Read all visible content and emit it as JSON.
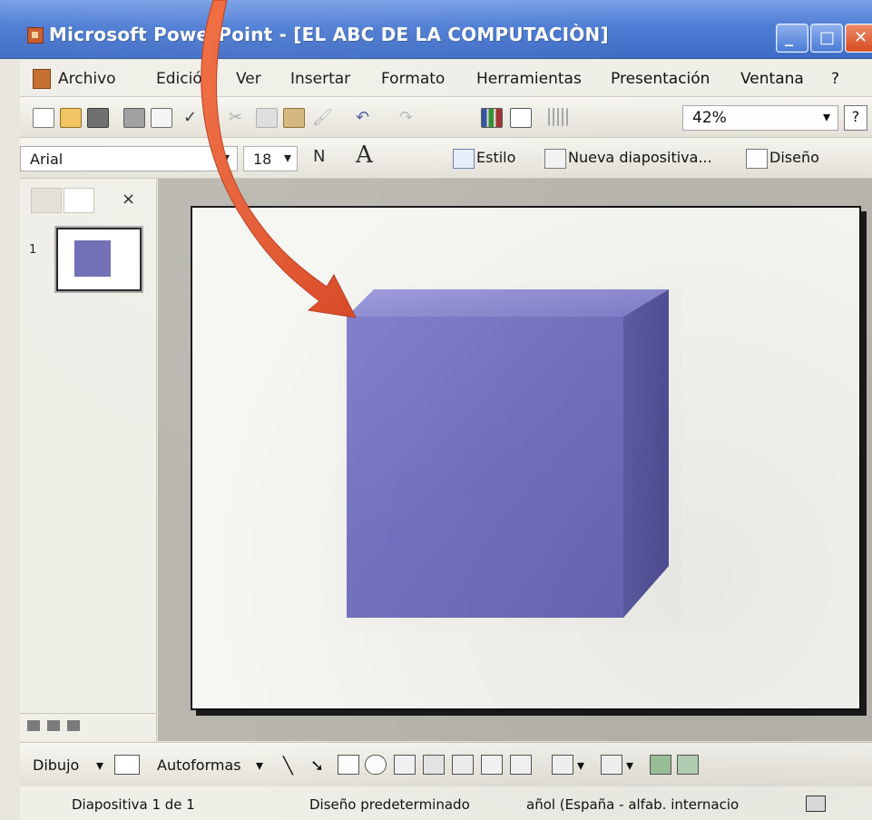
{
  "app": {
    "title": "Microsoft PowerPoint - [EL ABC DE LA COMPUTACIÒN]"
  },
  "menu": {
    "items": [
      "Archivo",
      "Edición",
      "Ver",
      "Insertar",
      "Formato",
      "Herramientas",
      "Presentación",
      "Ventana",
      "?"
    ]
  },
  "toolbar": {
    "zoom": "42%",
    "help_label": "?"
  },
  "format": {
    "font": "Arial",
    "size": "18",
    "bold_label": "N",
    "grow_label": "A",
    "style_label": "Estilo",
    "new_slide_label": "Nueva diapositiva...",
    "design_label": "Diseño"
  },
  "panes": {
    "close_label": "×",
    "slide_number": "1"
  },
  "drawing": {
    "dibujo_label": "Dibujo",
    "autoformas_label": "Autoformas"
  },
  "status": {
    "slide": "Diapositiva 1 de 1",
    "design": "Diseño predeterminado",
    "language": "añol (España - alfab. internacio"
  },
  "colors": {
    "cube_front": "#7270bb",
    "cube_top": "#8b89d2",
    "cube_side": "#5f5ca7",
    "arrow": "#e5532b"
  },
  "icons": {
    "titlebar": [
      "powerpoint-icon",
      "minimize-icon",
      "maximize-icon",
      "close-icon"
    ],
    "standard_toolbar": [
      "new-icon",
      "open-icon",
      "save-icon",
      "print-icon",
      "preview-icon",
      "spell-icon",
      "cut-icon",
      "copy-icon",
      "paste-icon",
      "format-painter-icon",
      "undo-icon",
      "redo-icon",
      "chart-icon",
      "table-icon",
      "grid-icon",
      "help-icon"
    ]
  }
}
